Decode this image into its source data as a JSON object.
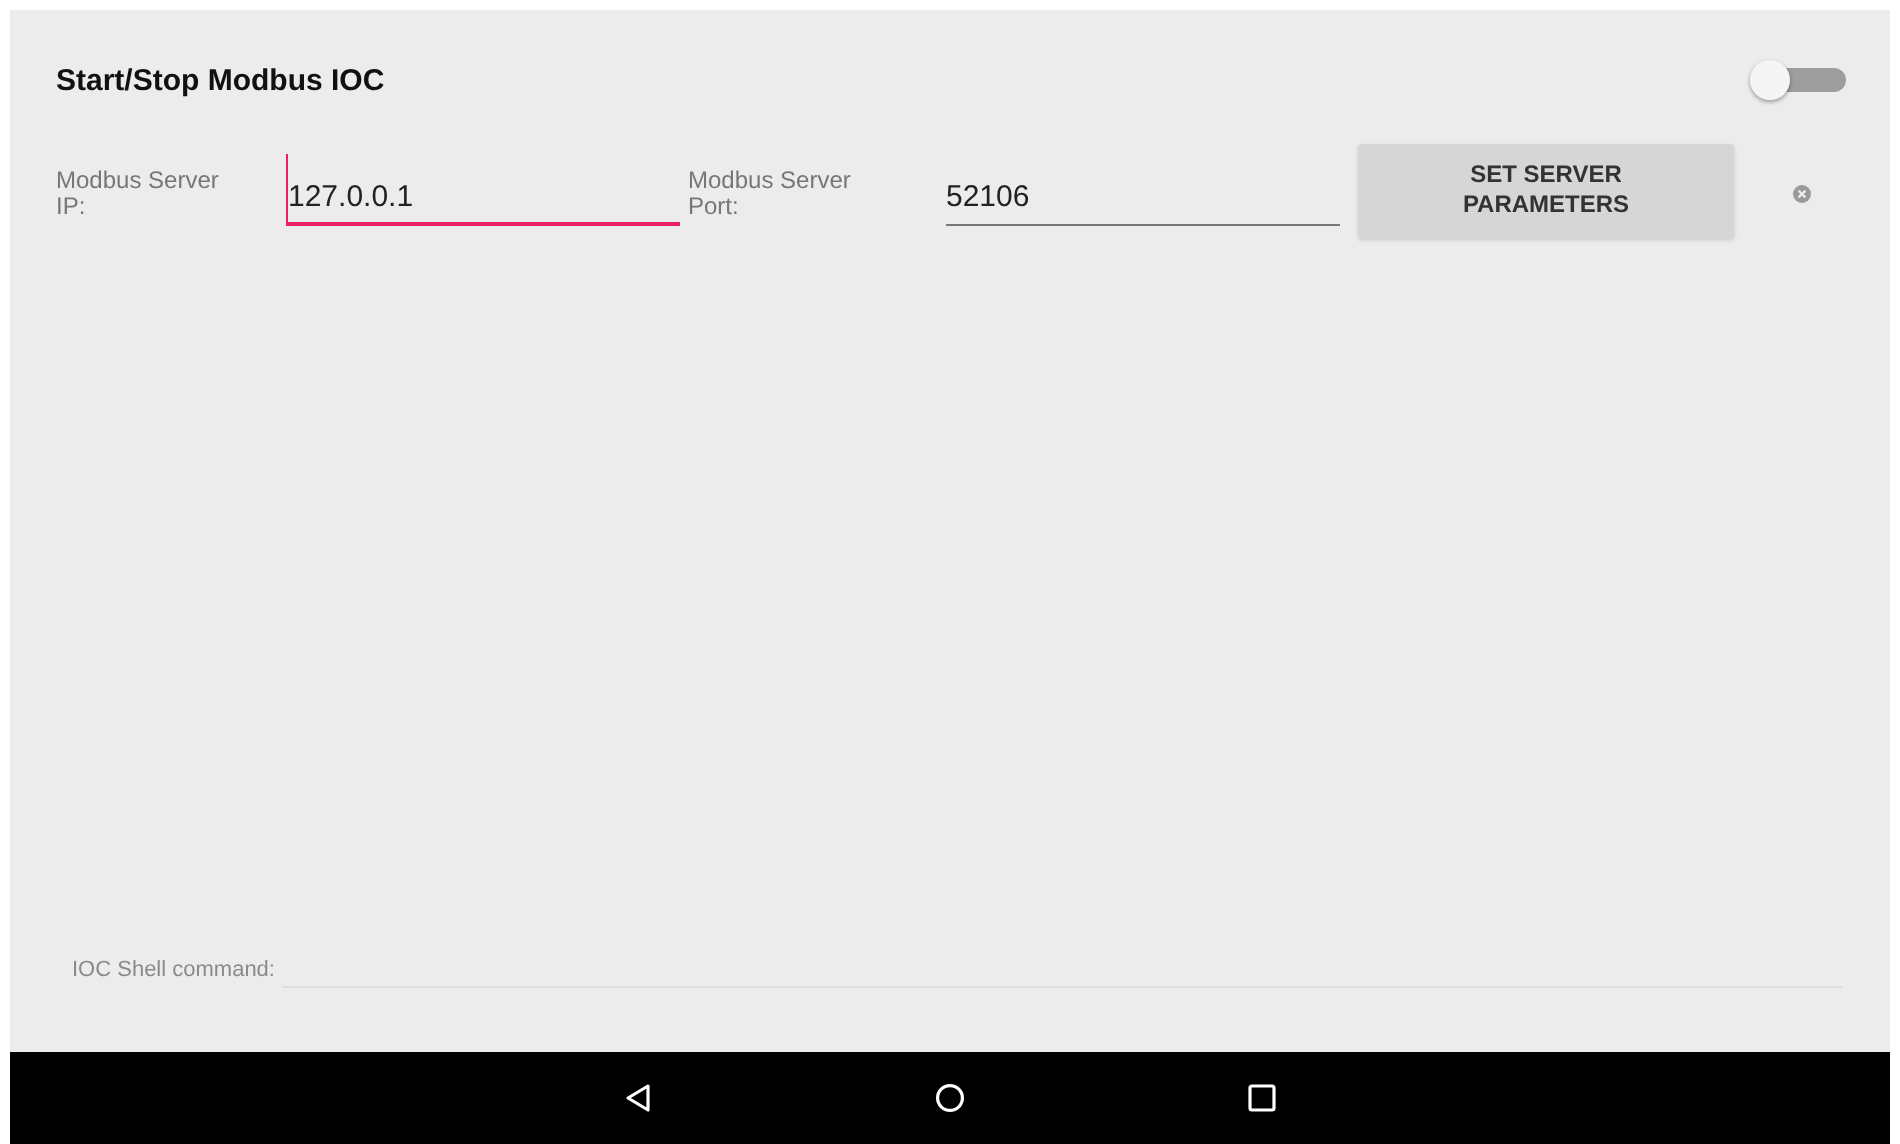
{
  "header": {
    "title": "Start/Stop Modbus IOC",
    "switch": {
      "on": false
    }
  },
  "fields": [
    {
      "label": "Modbus Server IP:",
      "value": "127.0.0.1",
      "focused": true
    },
    {
      "label": "Modbus Server Port:",
      "value": "52106",
      "focused": false
    }
  ],
  "button": {
    "label": "SET SERVER PARAMETERS"
  },
  "shell": {
    "label": "IOC Shell command:",
    "disabled": true
  }
}
